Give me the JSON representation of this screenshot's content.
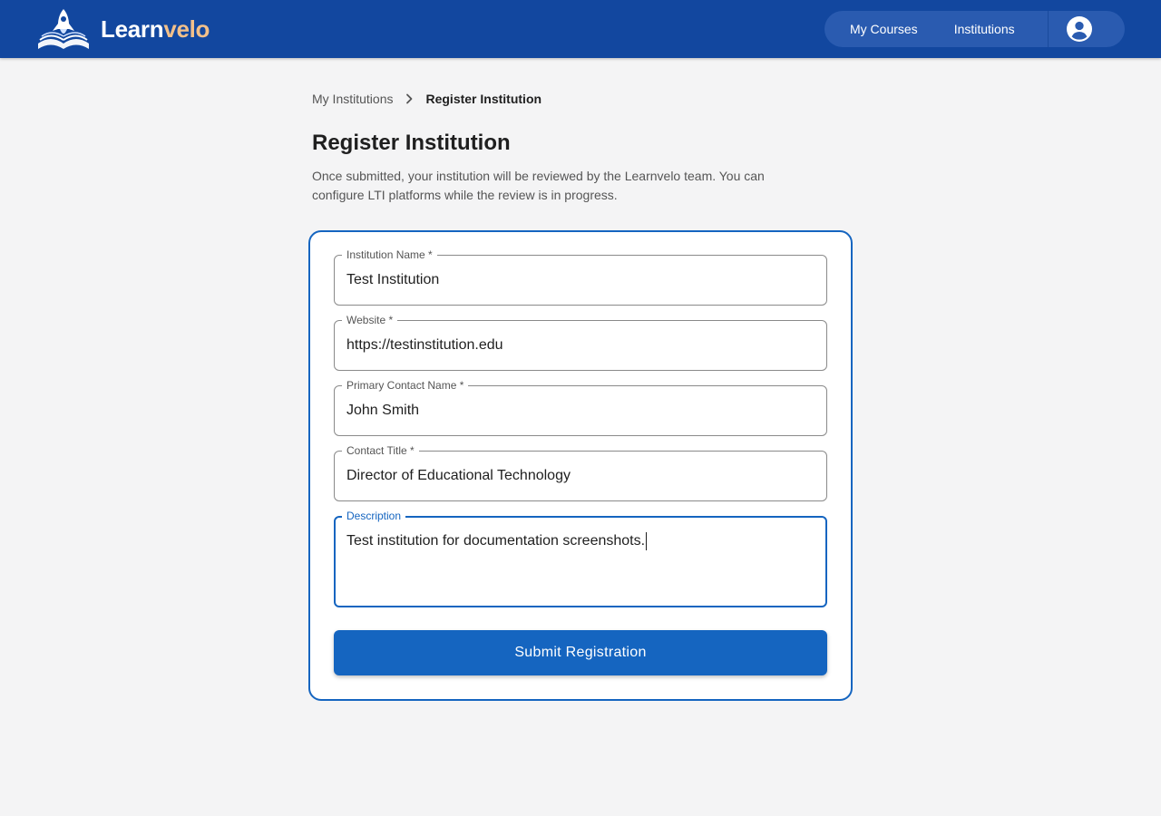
{
  "app": {
    "brand_part1": "Learn",
    "brand_part2": "velo",
    "logo_icon": "rocket-book-logo"
  },
  "nav": {
    "items": [
      {
        "label": "My Courses"
      },
      {
        "label": "Institutions"
      }
    ],
    "avatar_icon": "account-circle-icon"
  },
  "breadcrumb": {
    "parent": "My Institutions",
    "separator_icon": "chevron-right-icon",
    "current": "Register Institution"
  },
  "page": {
    "title": "Register Institution",
    "description": "Once submitted, your institution will be reviewed by the Learnvelo team. You can configure LTI platforms while the review is in progress."
  },
  "form": {
    "fields": [
      {
        "label": "Institution Name *",
        "value": "Test Institution"
      },
      {
        "label": "Website *",
        "value": "https://testinstitution.edu"
      },
      {
        "label": "Primary Contact Name *",
        "value": "John Smith"
      },
      {
        "label": "Contact Title *",
        "value": "Director of Educational Technology"
      },
      {
        "label": "Description",
        "value": "Test institution for documentation screenshots."
      }
    ],
    "submit_label": "Submit Registration"
  },
  "colors": {
    "header_bg": "#12479f",
    "primary": "#1565c0",
    "brand_accent": "#f2c08a",
    "page_bg": "#f4f4f5"
  }
}
